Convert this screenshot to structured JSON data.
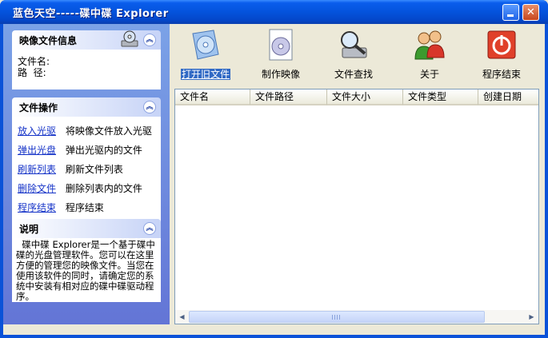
{
  "window": {
    "title": "蓝色天空-----碟中碟 Explorer",
    "minimize_icon": "minimize-icon",
    "close_icon": "close-icon"
  },
  "panels": {
    "image_info": {
      "title": "映像文件信息",
      "icon": "cd-drive-icon",
      "filename_label": "文件名:",
      "path_label": "路  径:"
    },
    "file_ops": {
      "title": "文件操作",
      "items": [
        {
          "link": "放入光驱",
          "desc": "将映像文件放入光驱"
        },
        {
          "link": "弹出光盘",
          "desc": "弹出光驱内的文件"
        },
        {
          "link": "刷新列表",
          "desc": "刷新文件列表"
        },
        {
          "link": "删除文件",
          "desc": "删除列表内的文件"
        },
        {
          "link": "程序结束",
          "desc": "程序结束"
        }
      ]
    },
    "about": {
      "title": "说明",
      "text": "  碟中碟 Explorer是一个基于碟中碟的光盘管理软件。您可以在这里方便的管理您的映像文件。当您在使用该软件的同时，请确定您的系统中安装有相对应的碟中碟驱动程序。"
    }
  },
  "toolbar": {
    "open": "打开旧文件",
    "make": "制作映像",
    "search": "文件查找",
    "about": "关于",
    "exit": "程序结束"
  },
  "list": {
    "columns": [
      "文件名",
      "文件路径",
      "文件大小",
      "文件类型",
      "创建日期"
    ]
  },
  "colors": {
    "titlebar": "#0453DC",
    "taskpane": "#7BA2E7",
    "link": "#1533C8",
    "selection": "#316AC5",
    "exit_red": "#E0402A"
  }
}
